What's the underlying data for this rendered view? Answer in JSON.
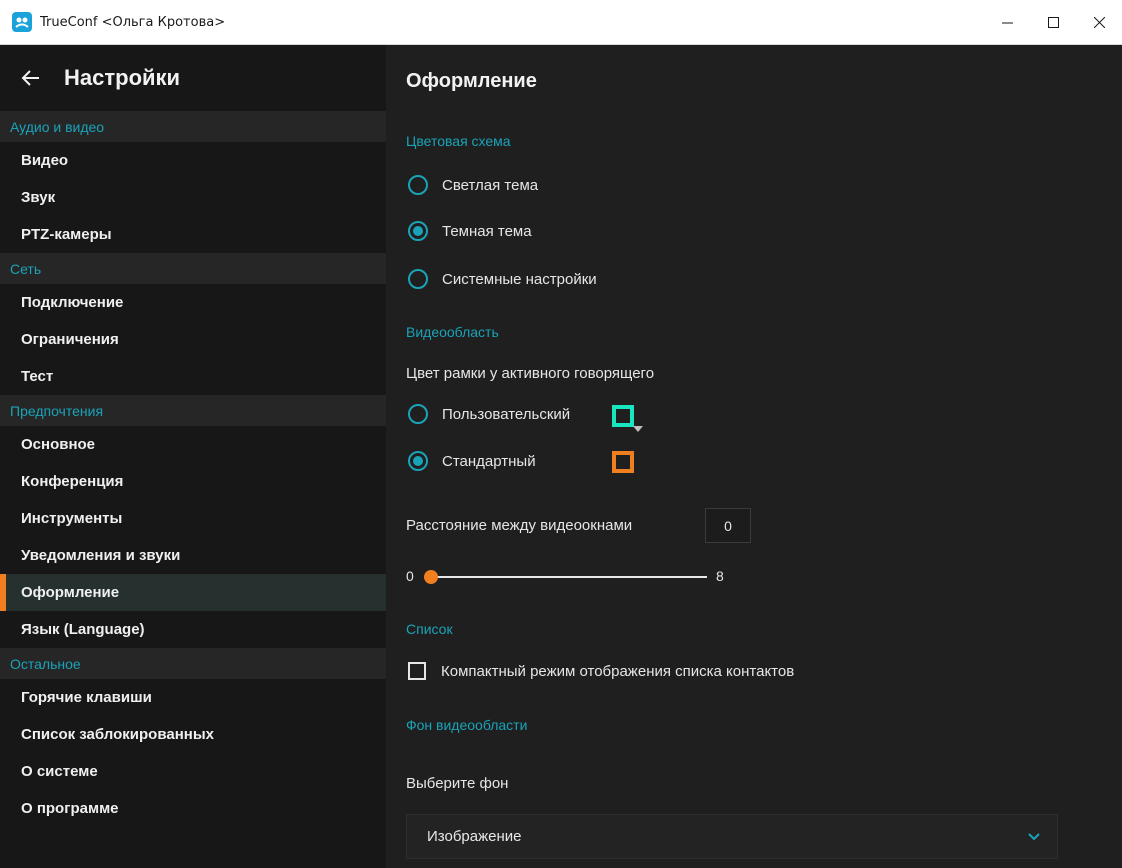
{
  "window": {
    "title": "TrueConf <Ольга Кротова>"
  },
  "sidebar": {
    "title": "Настройки",
    "sections": [
      {
        "label": "Аудио и видео",
        "items": [
          "Видео",
          "Звук",
          "PTZ-камеры"
        ]
      },
      {
        "label": "Сеть",
        "items": [
          "Подключение",
          "Ограничения",
          "Тест"
        ]
      },
      {
        "label": "Предпочтения",
        "items": [
          "Основное",
          "Конференция",
          "Инструменты",
          "Уведомления и звуки",
          "Оформление",
          "Язык (Language)"
        ]
      },
      {
        "label": "Остальное",
        "items": [
          "Горячие клавиши",
          "Список заблокированных",
          "О системе",
          "О программе"
        ]
      }
    ],
    "active_item": "Оформление"
  },
  "main": {
    "title": "Оформление",
    "color_scheme": {
      "label": "Цветовая схема",
      "options": [
        "Светлая тема",
        "Темная тема",
        "Системные настройки"
      ],
      "selected": "Темная тема"
    },
    "video_area": {
      "label": "Видеообласть",
      "frame_color_label": "Цвет рамки у активного говорящего",
      "options": [
        "Пользовательский",
        "Стандартный"
      ],
      "selected": "Стандартный",
      "custom_color": "#19e6c1",
      "standard_color": "#f07f1f",
      "spacing_label": "Расстояние между видеоокнами",
      "spacing_value": "0",
      "slider_min": "0",
      "slider_max": "8",
      "slider_value": 0
    },
    "list": {
      "label": "Список",
      "compact_mode_label": "Компактный режим отображения списка контактов",
      "compact_mode_checked": false
    },
    "background": {
      "label": "Фон видеообласти",
      "choose_label": "Выберите фон",
      "selected_value": "Изображение"
    }
  },
  "colors": {
    "accent": "#1aa3b8",
    "active_marker": "#f07f1f",
    "sidebar_bg": "#171717",
    "main_bg": "#1f1f1f"
  }
}
